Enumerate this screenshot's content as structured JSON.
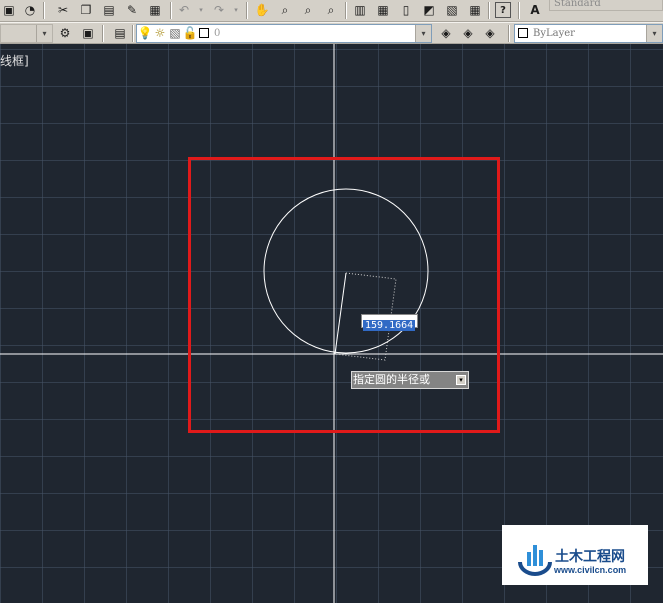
{
  "toolbar_top": {
    "style_combo": "Standard",
    "icons": [
      "save-icon",
      "plot-icon",
      "cut-icon",
      "copy-icon",
      "paste-icon",
      "match-properties-icon",
      "block-editor-icon",
      "undo-icon",
      "redo-icon",
      "pan-icon",
      "zoom-realtime-icon",
      "zoom-window-icon",
      "zoom-previous-icon",
      "properties-icon",
      "design-center-icon",
      "tool-palettes-icon",
      "sheet-set-icon",
      "markup-icon",
      "calculator-icon",
      "help-icon",
      "text-style-icon"
    ]
  },
  "toolbar_layers": {
    "layer_value": "0",
    "linetype_value": "ByLayer"
  },
  "viewport_label": "线框]",
  "dynamic_input": {
    "value": "159.1664"
  },
  "tooltip": {
    "prompt": "指定圆的半径或"
  },
  "watermark": {
    "name": "土木工程网",
    "url": "www.civilcn.com"
  },
  "colors": {
    "background": "#1f2630",
    "highlight": "#e01a1a",
    "crosshair": "#ffffff"
  }
}
